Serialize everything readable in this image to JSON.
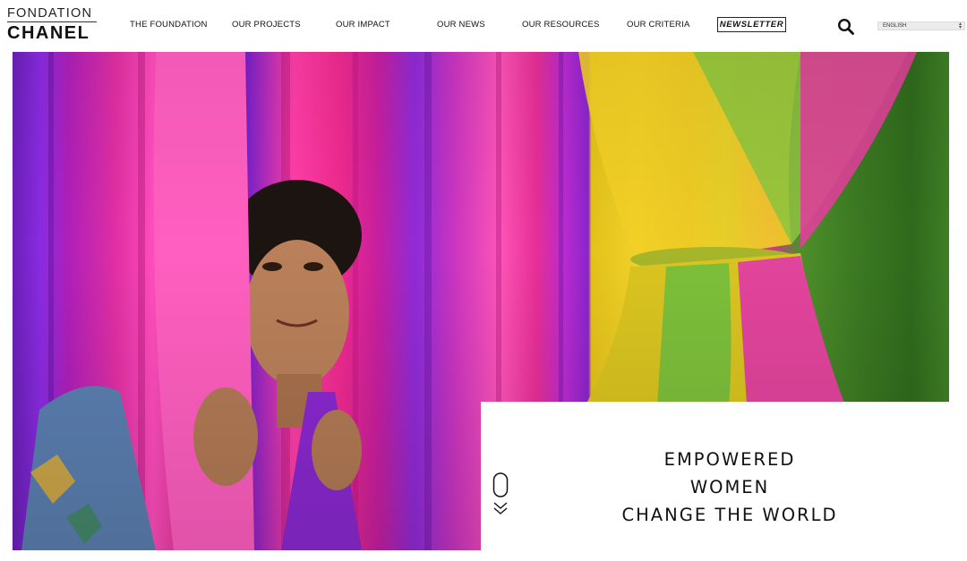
{
  "logo": {
    "line1": "FONDATION",
    "line2": "CHANEL"
  },
  "nav": {
    "items": [
      {
        "label": "THE FOUNDATION"
      },
      {
        "label": "OUR PROJECTS"
      },
      {
        "label": "OUR IMPACT"
      },
      {
        "label": "OUR NEWS"
      },
      {
        "label": "OUR RESOURCES"
      },
      {
        "label": "OUR CRITERIA"
      }
    ],
    "newsletter_label": "NEWSLETTER",
    "search_icon": "search-icon",
    "language": {
      "selected": "ENGLISH"
    }
  },
  "hero": {
    "headline": [
      "EMPOWERED",
      "WOMEN",
      "CHANGE THE WORLD"
    ],
    "scroll_icon": "scroll-down-icon"
  },
  "colors": {
    "text": "#111111",
    "background": "#ffffff",
    "magenta": "#ff3ea7",
    "purple": "#8a2be2",
    "yellow": "#f2d22a",
    "green": "#3c7a22"
  }
}
